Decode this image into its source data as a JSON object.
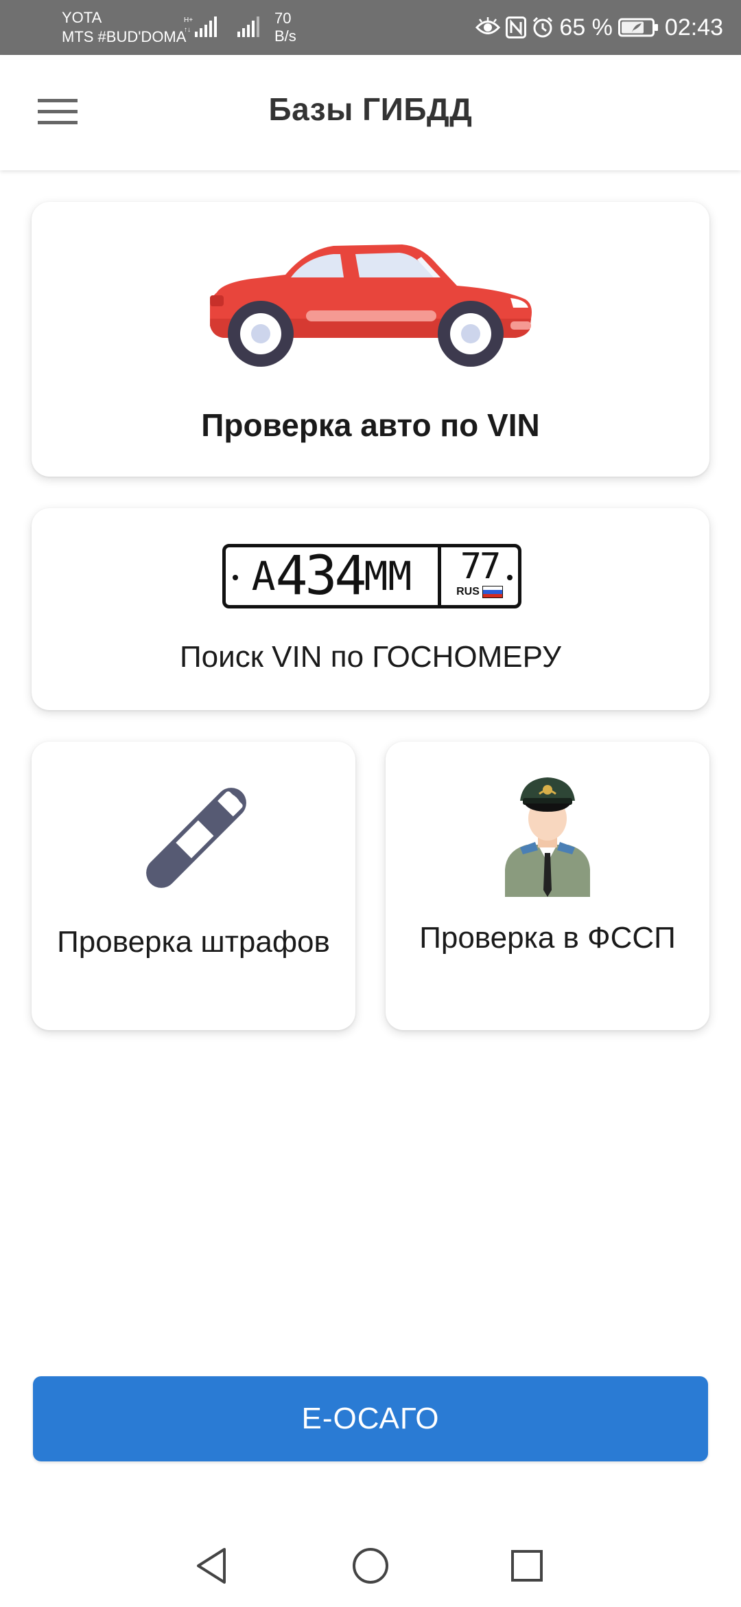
{
  "status_bar": {
    "carrier1": "YOTA",
    "carrier2": "MTS #BUD'DOMA",
    "speed_value": "70",
    "speed_unit": "B/s",
    "battery_percent": "65 %",
    "time": "02:43"
  },
  "app_bar": {
    "title": "Базы ГИБДД"
  },
  "cards": {
    "vin_check": "Проверка авто по VIN",
    "plate_search": "Поиск VIN по ГОСНОМЕРУ",
    "fines": "Проверка штрафов",
    "fssp": "Проверка в ФССП"
  },
  "plate": {
    "letter1": "А",
    "digits": "434",
    "letters2": "ММ",
    "region": "77",
    "country": "RUS"
  },
  "bottom_button": {
    "label": "Е-ОСАГО"
  },
  "colors": {
    "status_bar": "#707070",
    "accent_button": "#2a7bd4",
    "car_body": "#e8453c"
  }
}
